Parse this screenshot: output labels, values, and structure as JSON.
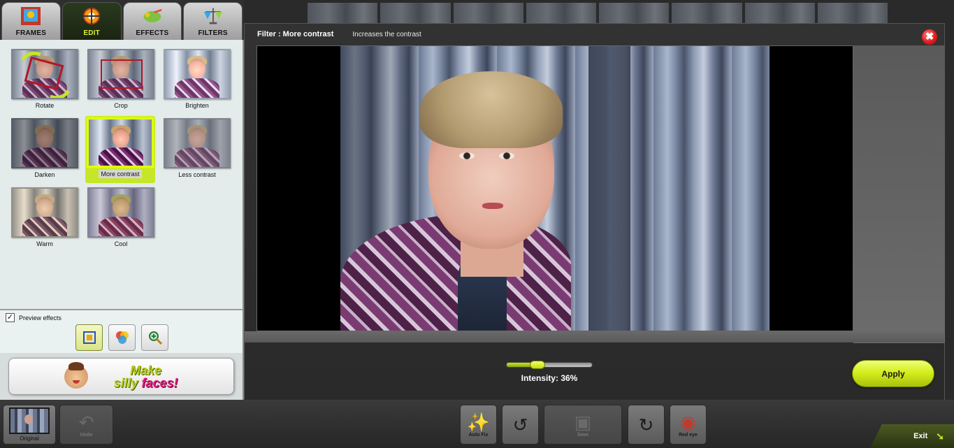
{
  "tabs": [
    {
      "label": "FRAMES",
      "icon": "frames-icon"
    },
    {
      "label": "EDIT",
      "icon": "edit-icon",
      "active": true
    },
    {
      "label": "EFFECTS",
      "icon": "effects-icon"
    },
    {
      "label": "FILTERS",
      "icon": "filters-icon"
    }
  ],
  "edit_tools": [
    {
      "label": "Rotate"
    },
    {
      "label": "Crop"
    },
    {
      "label": "Brighten"
    },
    {
      "label": "Darken"
    },
    {
      "label": "More contrast",
      "selected": true
    },
    {
      "label": "Less contrast"
    },
    {
      "label": "Warm"
    },
    {
      "label": "Cool"
    }
  ],
  "preview": {
    "checkbox_label": "Preview effects",
    "checked": true,
    "checkbox_mark": "✓",
    "modes": [
      "crop-mode-icon",
      "color-mode-icon",
      "zoom-mode-icon"
    ]
  },
  "silly_faces": {
    "line1": "Make",
    "line2a": "silly",
    "line2b": "faces!"
  },
  "dialog": {
    "title": "Filter : More contrast",
    "description": "Increases the contrast",
    "close_symbol": "✖",
    "intensity_label": "Intensity: 36%",
    "intensity_value": 0.36,
    "apply_label": "Apply"
  },
  "bottom_toolbar": {
    "original_label": "Original",
    "undo_label": "Undo",
    "auto_fix_label": "Auto Fix",
    "save_label": "Save",
    "red_eye_label": "Red eye",
    "exit_label": "Exit"
  },
  "colors": {
    "accent": "#c6e62a",
    "close": "#e11d1d",
    "apply": "#d4ee1c"
  }
}
